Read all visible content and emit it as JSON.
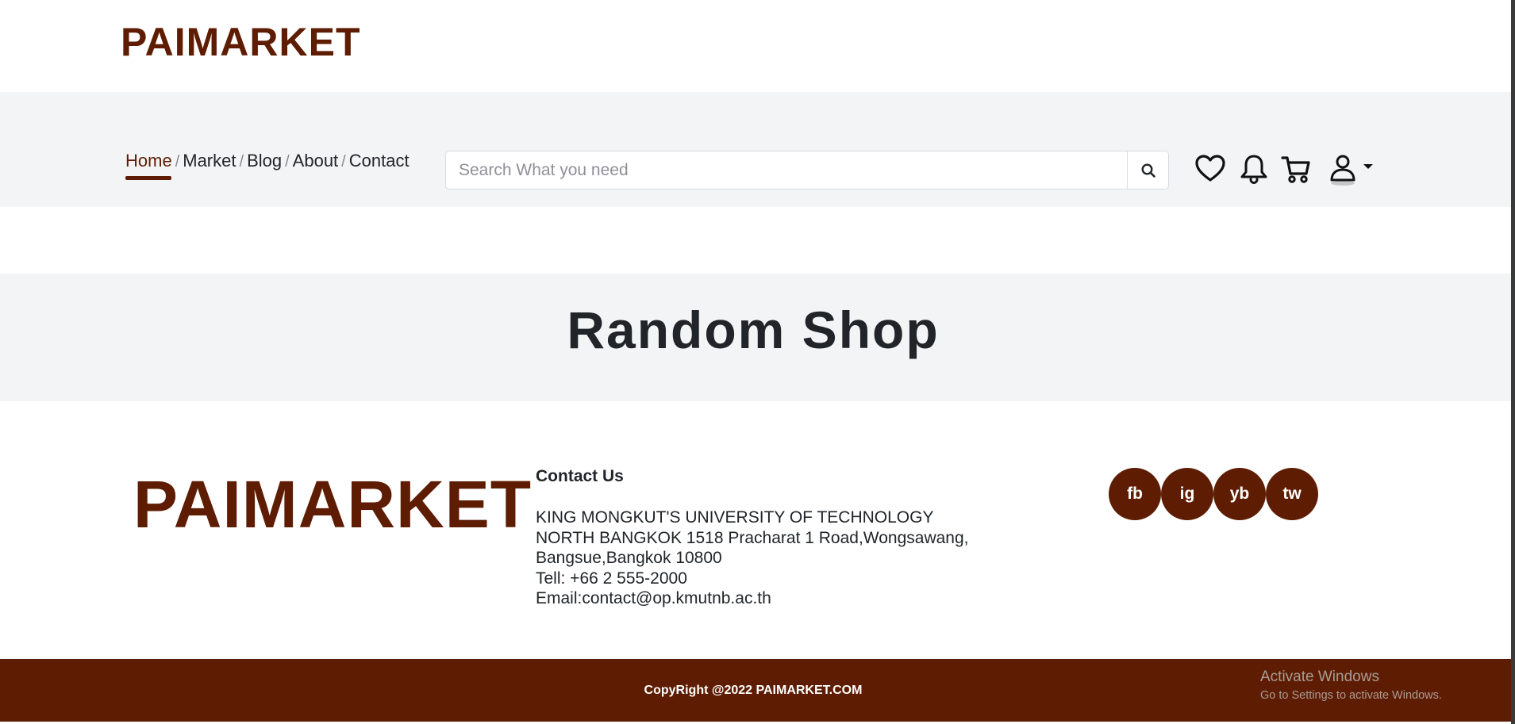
{
  "header": {
    "logo": "PAIMARKET"
  },
  "nav": {
    "links": [
      {
        "label": "Home",
        "active": true
      },
      {
        "label": "Market"
      },
      {
        "label": "Blog"
      },
      {
        "label": "About"
      },
      {
        "label": "Contact"
      }
    ],
    "separator": "/"
  },
  "search": {
    "placeholder": "Search What you need",
    "button_icon": "search-icon"
  },
  "icons": [
    "heart-icon",
    "bell-icon",
    "cart-icon",
    "user-icon",
    "caret-down-icon"
  ],
  "hero": {
    "title": "Random Shop"
  },
  "footer": {
    "logo": "PAIMARKET",
    "contact_heading": "Contact Us",
    "address_lines": [
      "KING MONGKUT'S UNIVERSITY OF TECHNOLOGY",
      "NORTH BANGKOK 1518 Pracharat 1 Road,Wongsawang,",
      "Bangsue,Bangkok 10800",
      "Tell: +66 2 555-2000",
      "Email:contact@op.kmutnb.ac.th"
    ],
    "socials": [
      "fb",
      "ig",
      "yb",
      "tw"
    ],
    "copyright": "CopyRight @2022 PAIMARKET.COM"
  },
  "watermark": {
    "title": "Activate Windows",
    "subtitle": "Go to Settings to activate Windows."
  },
  "colors": {
    "brand": "#5e1d03",
    "band": "#f2f4f5",
    "text": "#212529"
  }
}
